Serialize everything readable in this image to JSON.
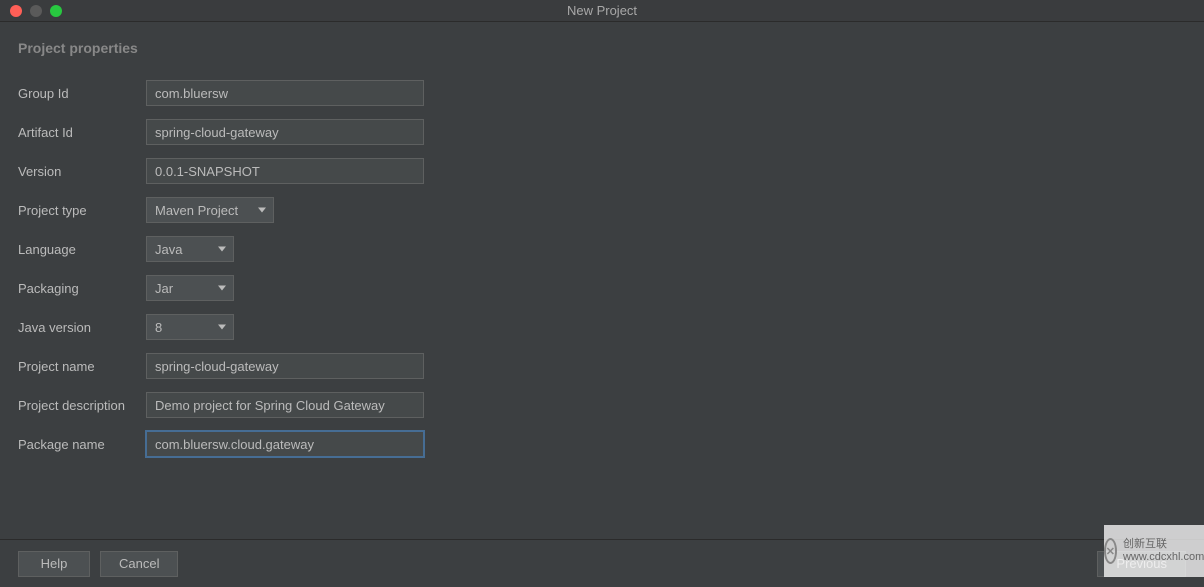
{
  "window": {
    "title": "New Project"
  },
  "section": {
    "title": "Project properties"
  },
  "fields": {
    "groupId": {
      "label": "Group Id",
      "value": "com.bluersw"
    },
    "artifactId": {
      "label": "Artifact Id",
      "value": "spring-cloud-gateway"
    },
    "version": {
      "label": "Version",
      "value": "0.0.1-SNAPSHOT"
    },
    "projectType": {
      "label": "Project type",
      "value": "Maven Project"
    },
    "language": {
      "label": "Language",
      "value": "Java"
    },
    "packaging": {
      "label": "Packaging",
      "value": "Jar"
    },
    "javaVersion": {
      "label": "Java version",
      "value": "8"
    },
    "projectName": {
      "label": "Project name",
      "value": "spring-cloud-gateway"
    },
    "projectDescription": {
      "label": "Project description",
      "value": "Demo project for Spring Cloud Gateway"
    },
    "packageName": {
      "label": "Package name",
      "value": "com.bluersw.cloud.gateway"
    }
  },
  "buttons": {
    "help": "Help",
    "cancel": "Cancel",
    "previous": "Previous"
  },
  "watermark": {
    "line1": "创新互联",
    "line2": "www.cdcxhl.com"
  }
}
